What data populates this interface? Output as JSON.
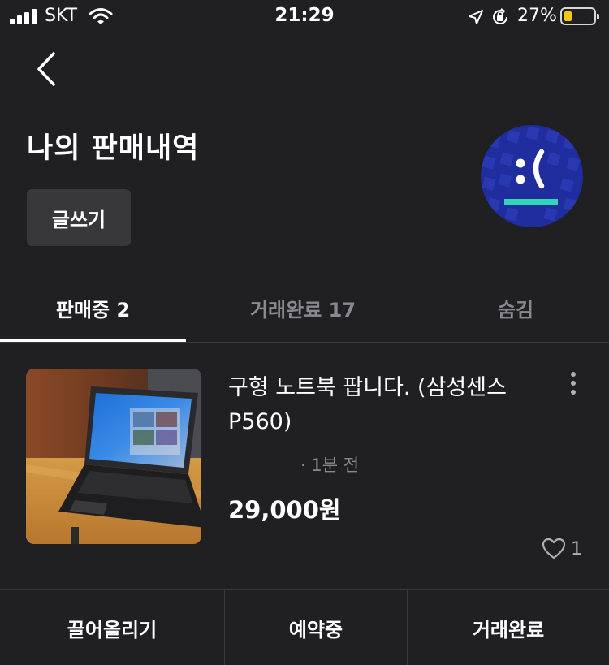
{
  "status_bar": {
    "carrier": "SKT",
    "time": "21:29",
    "battery_percent": "27%",
    "battery_level": 0.27
  },
  "header": {
    "back_icon": "chevron-left-icon",
    "title": "나의 판매내역",
    "write_button": "글쓰기",
    "avatar_icon": "sad-face-avatar-icon"
  },
  "tabs": [
    {
      "label": "판매중 2",
      "active": true
    },
    {
      "label": "거래완료 17",
      "active": false
    },
    {
      "label": "숨김",
      "active": false
    }
  ],
  "items": [
    {
      "title": "구형 노트북 팝니다. (삼성센스 P560)",
      "meta": "· 1분 전",
      "price": "29,000원",
      "likes": "1",
      "thumbnail": "laptop-photo"
    }
  ],
  "actions": [
    {
      "label": "끌어올리기"
    },
    {
      "label": "예약중"
    },
    {
      "label": "거래완료"
    }
  ],
  "colors": {
    "background": "#202023",
    "text": "#ffffff",
    "muted": "#8a8a8e",
    "button_bg": "#38383b",
    "avatar_bg": "#1f2d9e",
    "avatar_accent": "#2fd6b8",
    "battery": "#f5c518"
  }
}
